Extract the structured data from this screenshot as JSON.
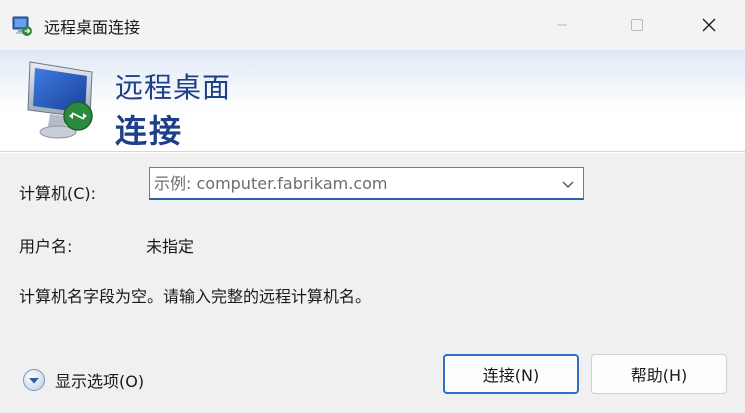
{
  "window": {
    "title": "远程桌面连接"
  },
  "banner": {
    "line1": "远程桌面",
    "line2": "连接"
  },
  "form": {
    "computer_label": "计算机(C):",
    "computer_value": "",
    "computer_placeholder": "示例: computer.fabrikam.com",
    "username_label": "用户名:",
    "username_value": "未指定",
    "message": "计算机名字段为空。请输入完整的远程计算机名。"
  },
  "footer": {
    "show_options_label": "显示选项(O)",
    "connect_label": "连接(N)",
    "help_label": "帮助(H)"
  },
  "colors": {
    "accent": "#2f6fc8",
    "banner_text": "#1e3f8a"
  },
  "icons": {
    "app": "remote-desktop-icon",
    "banner": "remote-desktop-monitor-icon",
    "options": "expand-options-icon",
    "dropdown": "chevron-down-icon"
  }
}
